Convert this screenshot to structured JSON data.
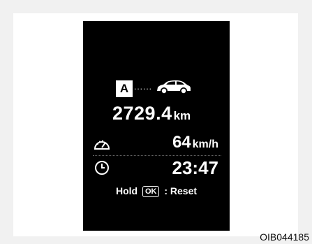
{
  "trip": {
    "mode": "A",
    "dots": "......"
  },
  "distance": {
    "value": "2729.4",
    "unit": "km"
  },
  "speed": {
    "value": "64",
    "unit": "km/h"
  },
  "time": "23:47",
  "hint": {
    "prefix": "Hold",
    "key": "OK",
    "suffix": ": Reset"
  },
  "figure_code": "OIB044185",
  "icons": [
    "car-icon",
    "speedometer-icon",
    "clock-icon"
  ]
}
